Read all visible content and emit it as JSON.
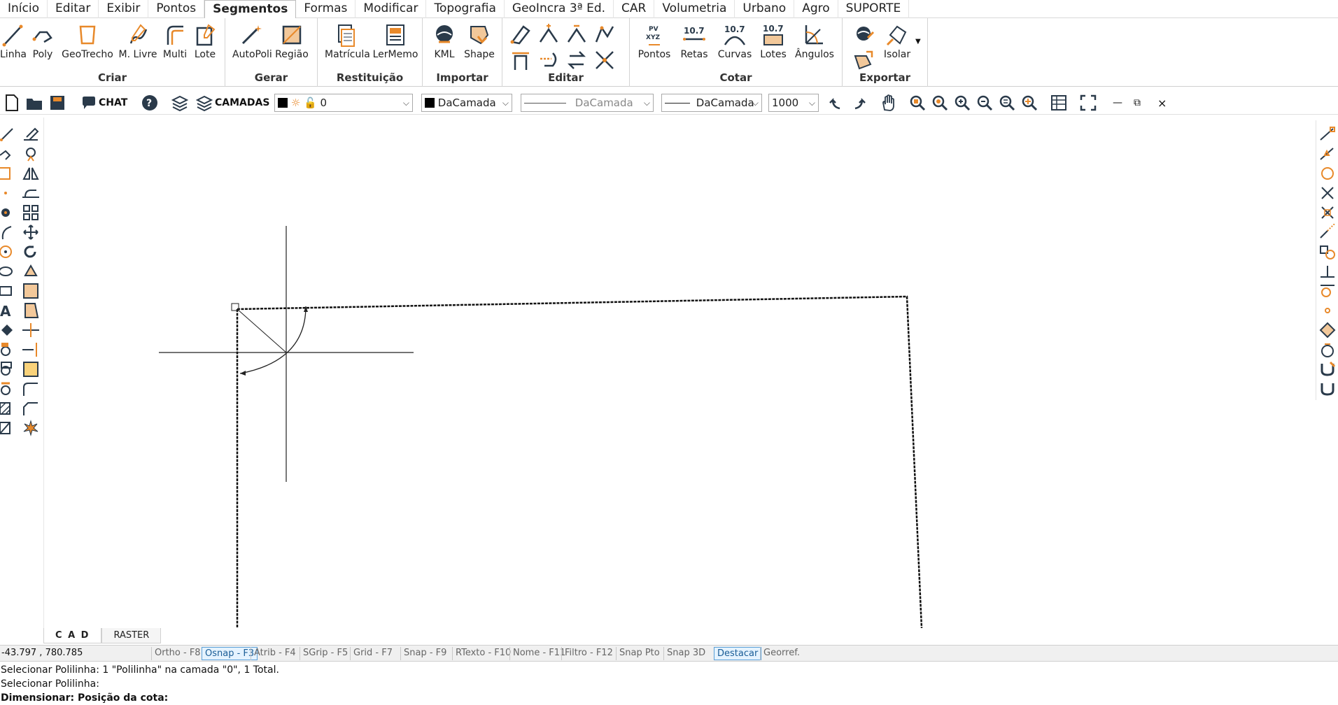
{
  "menu": {
    "items": [
      "Início",
      "Editar",
      "Exibir",
      "Pontos",
      "Segmentos",
      "Formas",
      "Modificar",
      "Topografia",
      "GeoIncra 3ª Ed.",
      "CAR",
      "Volumetria",
      "Urbano",
      "Agro",
      "SUPORTE"
    ],
    "active": "Segmentos"
  },
  "ribbon": {
    "groups": {
      "criar": "Criar",
      "gerar": "Gerar",
      "restituicao": "Restituição",
      "importar": "Importar",
      "editar": "Editar",
      "cotar": "Cotar",
      "exportar": "Exportar"
    },
    "buttons": {
      "linha": "Linha",
      "poly": "Poly",
      "geotrecho": "GeoTrecho",
      "mlivre": "M. Livre",
      "multi": "Multi",
      "lote": "Lote",
      "autopoli": "AutoPoli",
      "regiao": "Região",
      "matricula": "Matrícula",
      "lermemo": "LerMemo",
      "kml": "KML",
      "shape": "Shape",
      "pontos": "Pontos",
      "retas": "Retas",
      "curvas": "Curvas",
      "lotes": "Lotes",
      "angulos": "Ângulos",
      "isolar": "Isolar"
    },
    "icon_text": {
      "pontos_pv": "PV",
      "pontos_xyz": "XYZ",
      "retas_num": "10.7",
      "curvas_num": "10.7",
      "lotes_num": "10.7"
    }
  },
  "toolbar": {
    "chat_label": "CHAT",
    "camadas_label": "CAMADAS",
    "layer_value": "0",
    "color_value": "DaCamada",
    "linetype_value": "DaCamada",
    "lineweight_value": "DaCamada",
    "scale_value": "1000"
  },
  "tabs": [
    "C A D",
    "RASTER"
  ],
  "status": {
    "coords": "-43.797 , 780.785",
    "toggles": [
      {
        "label": "Ortho - F8",
        "on": false
      },
      {
        "label": "Osnap - F3",
        "on": true
      },
      {
        "label": "Atrib - F4",
        "on": false
      },
      {
        "label": "SGrip - F5",
        "on": false
      },
      {
        "label": "Grid - F7",
        "on": false
      },
      {
        "label": "Snap - F9",
        "on": false
      },
      {
        "label": "RTexto - F10",
        "on": false
      },
      {
        "label": "Nome - F11",
        "on": false
      },
      {
        "label": "Filtro - F12",
        "on": false
      },
      {
        "label": "Snap Pto",
        "on": false
      },
      {
        "label": "Snap 3D",
        "on": false
      },
      {
        "label": "Destacar",
        "on": true
      },
      {
        "label": "Georref.",
        "on": false
      }
    ]
  },
  "command_lines": [
    "Selecionar Polilinha: 1 \"Polilinha\" na camada \"0\", 1 Total.",
    "Selecionar Polilinha:",
    "Dimensionar: Posição da cota:"
  ],
  "colors": {
    "accent_orange": "#e8892a",
    "icon_dark": "#2a3a4a",
    "toggle_on_border": "#5aa0d8"
  }
}
